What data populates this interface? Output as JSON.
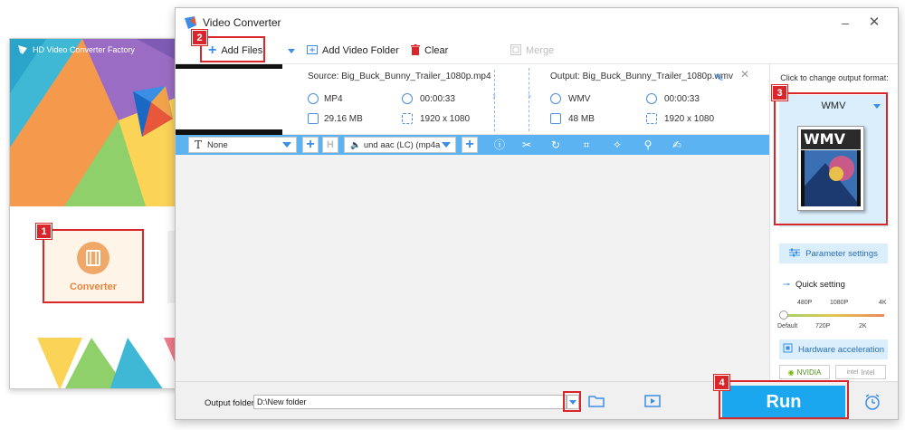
{
  "back_window": {
    "title": "HD Video Converter Factory",
    "converter_label": "Converter"
  },
  "main_window": {
    "title": "Video Converter",
    "minimize_glyph": "–",
    "close_glyph": "✕"
  },
  "toolbar": {
    "add_files": "Add Files",
    "add_video_folder": "Add Video Folder",
    "clear": "Clear",
    "merge": "Merge"
  },
  "file": {
    "source": "Source: Big_Buck_Bunny_Trailer_1080p.mp4",
    "output": "Output: Big_Buck_Bunny_Trailer_1080p.wmv",
    "source_format": "MP4",
    "source_duration": "00:00:33",
    "source_size": "29.16 MB",
    "source_resolution": "1920 x 1080",
    "output_format": "WMV",
    "output_duration": "00:00:33",
    "output_size": "48 MB",
    "output_resolution": "1920 x 1080"
  },
  "blue_bar": {
    "subtitle_select": "None",
    "audio_select": "und aac (LC) (mp4a"
  },
  "right_panel": {
    "hint": "Click to change output format:",
    "format": "WMV",
    "format_art_text": "WMV",
    "param_settings": "Parameter settings",
    "quick_setting": "Quick setting",
    "ticks_top": [
      "480P",
      "1080P",
      "4K"
    ],
    "ticks_bottom": [
      "Default",
      "720P",
      "2K"
    ],
    "hw_accel": "Hardware acceleration",
    "gpu_nvidia": "NVIDIA",
    "gpu_intel": "Intel"
  },
  "bottom": {
    "output_folder_label": "Output folder:",
    "output_folder_value": "D:\\New folder",
    "run": "Run"
  },
  "badges": [
    "1",
    "2",
    "3",
    "4"
  ],
  "colors": {
    "accent_blue": "#1aa7ef",
    "bar_blue": "#5cb3f2",
    "highlight_red": "#d9262b",
    "converter_orange": "#e8843c"
  }
}
